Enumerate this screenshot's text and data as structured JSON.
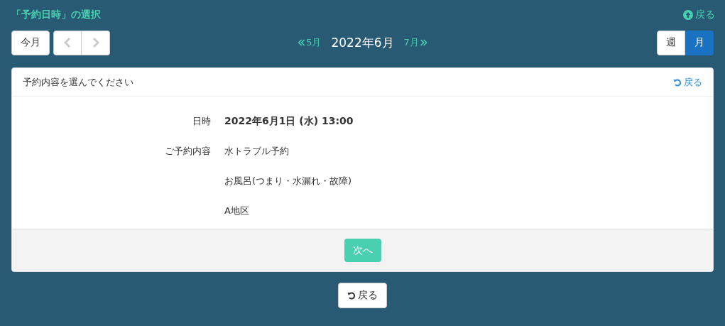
{
  "header": {
    "title": "「予約日時」の選択",
    "back_link": "戻る"
  },
  "toolbar": {
    "today_button": "今月",
    "prev_month": "5月",
    "current_month": "2022年6月",
    "next_month": "7月",
    "view_tabs": [
      {
        "label": "週",
        "selected": false
      },
      {
        "label": "月",
        "selected": true
      }
    ]
  },
  "panel": {
    "title": "予約内容を選んでください",
    "back_link": "戻る",
    "rows": [
      {
        "label": "日時",
        "value": "2022年6月1日 (水) 13:00",
        "kind": "strong"
      },
      {
        "label": "ご予約内容",
        "value": "水トラブル予約",
        "kind": "plain"
      },
      {
        "value": "お風呂(つまり・水漏れ・故障)",
        "kind": "plain"
      },
      {
        "value": "A地区",
        "kind": "plain"
      }
    ],
    "next_button": "次へ"
  },
  "back_button": "戻る"
}
